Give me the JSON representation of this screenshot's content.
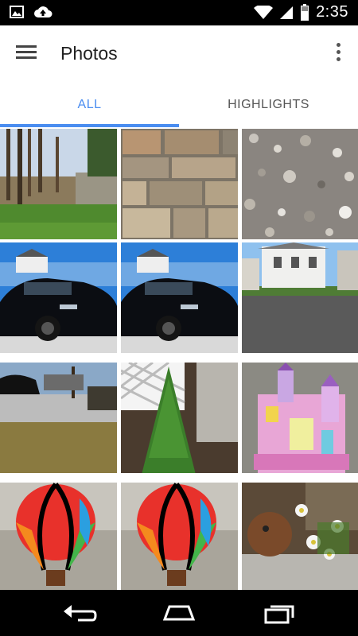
{
  "status_bar": {
    "time": "2:35",
    "left_icons": [
      "image-icon",
      "cloud-upload-icon"
    ],
    "right_icons": [
      "wifi-icon",
      "signal-icon",
      "battery-icon"
    ]
  },
  "app_bar": {
    "title": "Photos",
    "menu_icon": "menu-icon",
    "overflow_icon": "more-vert-icon"
  },
  "tabs": [
    {
      "label": "ALL",
      "active": true
    },
    {
      "label": "HIGHLIGHTS",
      "active": false
    }
  ],
  "colors": {
    "accent": "#4a8df0",
    "app_bar_bg": "#ffffff",
    "status_bar_bg": "#000000",
    "nav_bar_bg": "#000000"
  },
  "photos": [
    {
      "subject": "tree-yard-photo"
    },
    {
      "subject": "stone-wall-photo"
    },
    {
      "subject": "gravel-photo"
    },
    {
      "subject": "black-car-photo-1"
    },
    {
      "subject": "black-car-photo-2"
    },
    {
      "subject": "street-house-photo"
    },
    {
      "subject": "lawn-car-photo"
    },
    {
      "subject": "evergreen-shrub-photo"
    },
    {
      "subject": "toy-castle-photo"
    },
    {
      "subject": "balloon-windspinner-photo-1"
    },
    {
      "subject": "balloon-windspinner-photo-2"
    },
    {
      "subject": "flower-planter-photo"
    }
  ],
  "nav_bar": {
    "icons": [
      "back-icon",
      "home-icon",
      "recents-icon"
    ]
  }
}
